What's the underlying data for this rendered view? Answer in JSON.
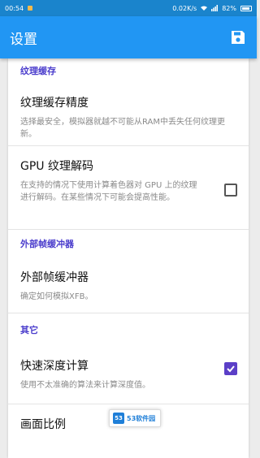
{
  "status_bar": {
    "time": "00:54",
    "network_speed": "0.02K/s",
    "battery": "82%",
    "icons": [
      "wifi-icon",
      "signal-icon",
      "battery-icon"
    ]
  },
  "app_bar": {
    "title": "设置",
    "save_icon": "save-icon"
  },
  "sections": [
    {
      "header": "纹理缓存",
      "items": [
        {
          "title": "纹理缓存精度",
          "summary": "选择最安全，模拟器就越不可能从RAM中丢失任何纹理更新。"
        },
        {
          "title": "GPU 纹理解码",
          "summary": "在支持的情况下使用计算着色器对 GPU 上的纹理进行解码。在某些情况下可能会提高性能。",
          "checked": false
        }
      ]
    },
    {
      "header": "外部帧缓冲器",
      "items": [
        {
          "title": "外部帧缓冲器",
          "summary": "确定如何模拟XFB。"
        }
      ]
    },
    {
      "header": "其它",
      "items": [
        {
          "title": "快速深度计算",
          "summary": "使用不太准确的算法来计算深度值。",
          "checked": true
        },
        {
          "title": "画面比例"
        }
      ]
    }
  ],
  "watermark": {
    "logo": "53",
    "text": "53软件园"
  },
  "colors": {
    "status_bar": "#1a84cc",
    "app_bar": "#2196f3",
    "section_header": "#4a3ccc",
    "checkbox_checked": "#5b3fc7"
  }
}
